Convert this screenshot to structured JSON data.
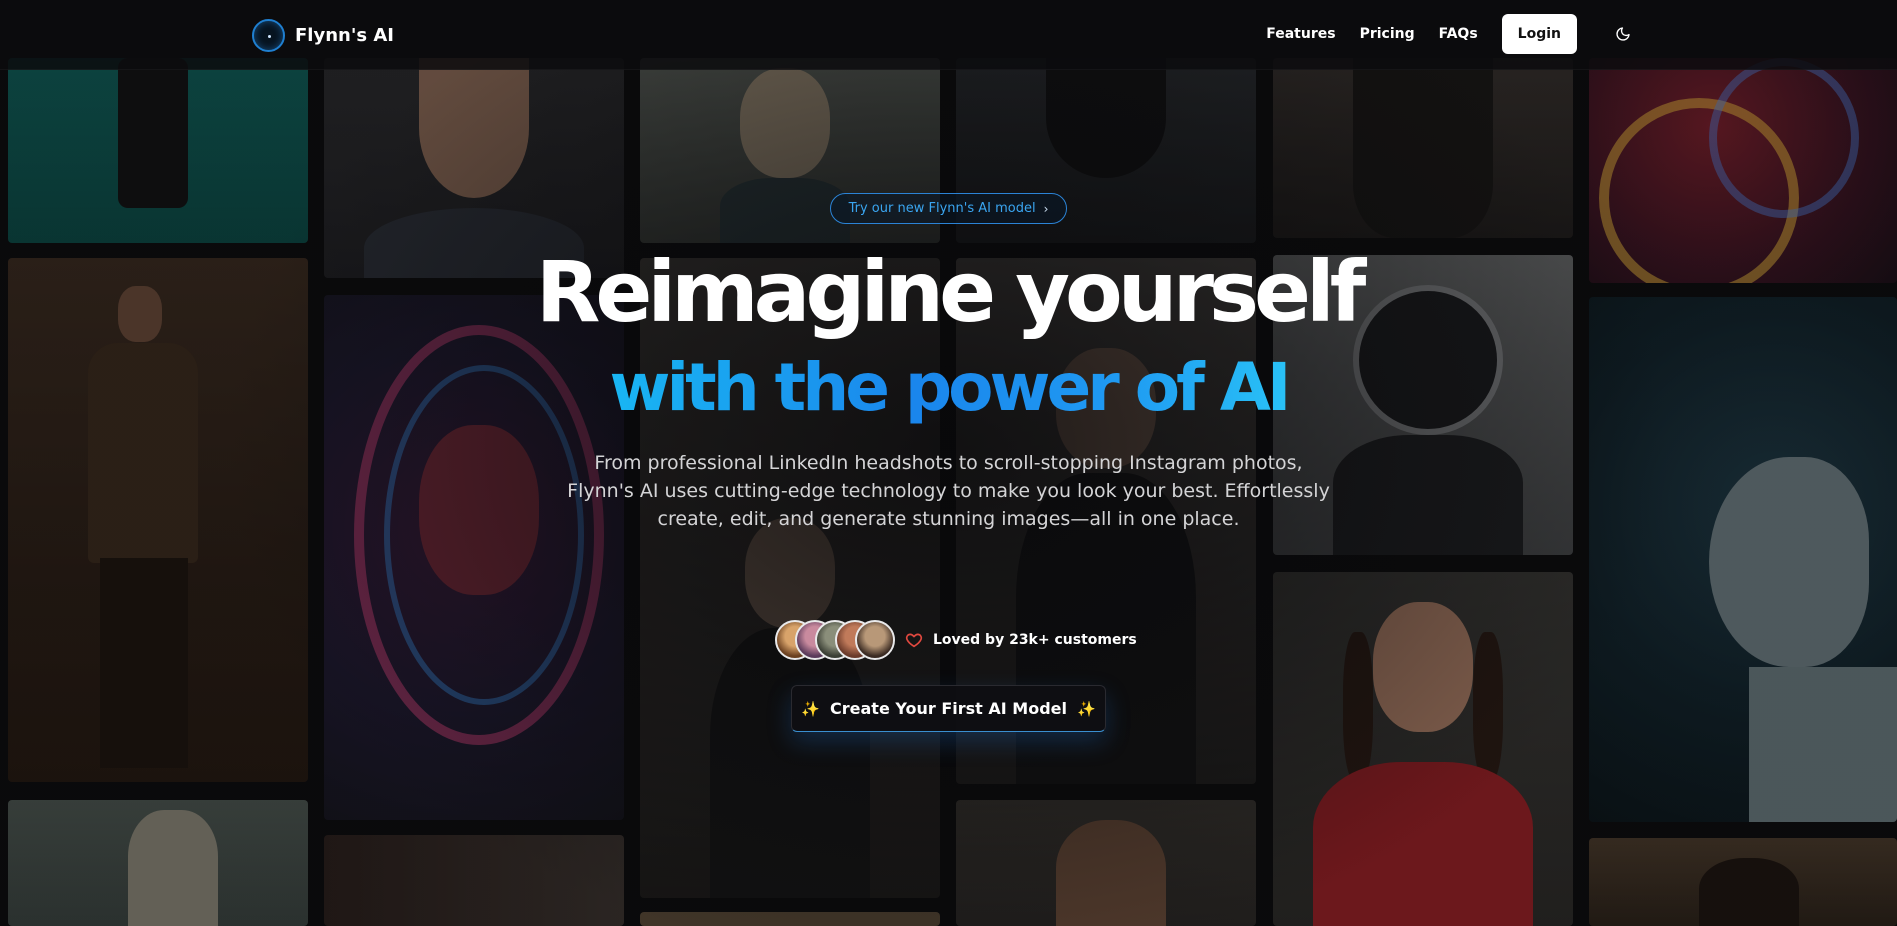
{
  "brand": {
    "name": "Flynn's AI",
    "logo_icon": "orb-logo-icon",
    "accent": "#1f7fd0"
  },
  "nav": {
    "links": [
      "Features",
      "Pricing",
      "FAQs"
    ],
    "login_label": "Login",
    "theme_icon": "moon-icon"
  },
  "hero": {
    "announcement": "Try our new Flynn's AI model",
    "announcement_icon": "chevron-right-icon",
    "headline": "Reimagine yourself",
    "subheadline": "with the power of AI",
    "subheadline_gradient": [
      "#19b6f3",
      "#1a86ec",
      "#29c1f6"
    ],
    "description": "From professional LinkedIn headshots to scroll-stopping Instagram photos, Flynn's AI uses cutting-edge technology to make you look your best. Effortlessly create, edit, and generate stunning images—all in one place.",
    "social_proof": {
      "text": "Loved by 23k+ customers",
      "icon": "heart-icon",
      "avatar_count": 5
    },
    "cta": {
      "label": "Create Your First AI Model",
      "icon": "sparkles-icon"
    }
  },
  "colors": {
    "background": "#0b0b0c",
    "announcement_border": "#2b83d6",
    "heart": "#e0483f"
  }
}
